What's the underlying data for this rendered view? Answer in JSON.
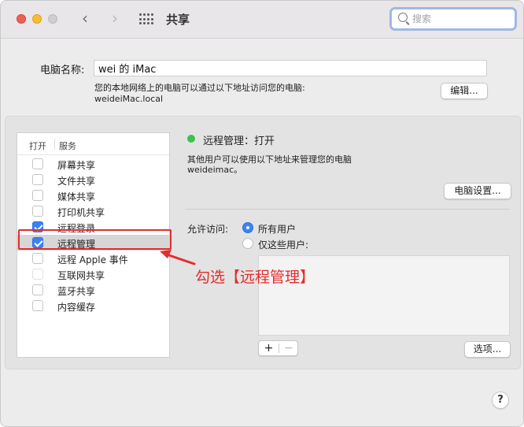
{
  "window": {
    "title": "共享",
    "search_placeholder": "搜索"
  },
  "computer": {
    "name_label": "电脑名称:",
    "name_value": "wei 的 iMac",
    "desc_line1": "您的本地网络上的电脑可以通过以下地址访问您的电脑:",
    "desc_line2": "weideiMac.local",
    "edit_button": "编辑..."
  },
  "services": {
    "header_on": "打开",
    "header_service": "服务",
    "items": [
      {
        "label": "屏幕共享",
        "checked": false,
        "dim": false
      },
      {
        "label": "文件共享",
        "checked": false,
        "dim": false
      },
      {
        "label": "媒体共享",
        "checked": false,
        "dim": false
      },
      {
        "label": "打印机共享",
        "checked": false,
        "dim": false
      },
      {
        "label": "远程登录",
        "checked": true,
        "dim": false
      },
      {
        "label": "远程管理",
        "checked": true,
        "dim": false,
        "selected": true
      },
      {
        "label": "远程 Apple 事件",
        "checked": false,
        "dim": false
      },
      {
        "label": "互联网共享",
        "checked": false,
        "dim": true
      },
      {
        "label": "蓝牙共享",
        "checked": false,
        "dim": false
      },
      {
        "label": "内容缓存",
        "checked": false,
        "dim": false
      }
    ]
  },
  "detail": {
    "status": "远程管理：打开",
    "status_color": "#3cc14c",
    "desc_line1": "其他用户可以使用以下地址来管理您的电脑",
    "desc_line2": "weideimac。",
    "settings_button": "电脑设置...",
    "allow_label": "允许访问:",
    "radio_all": "所有用户",
    "radio_some": "仅这些用户:",
    "selected_radio": "all",
    "add_button": "+",
    "remove_button": "−",
    "options_button": "选项..."
  },
  "annotation": {
    "text": "勾选【远程管理】",
    "color": "#e32d2d"
  },
  "help_button": "?"
}
